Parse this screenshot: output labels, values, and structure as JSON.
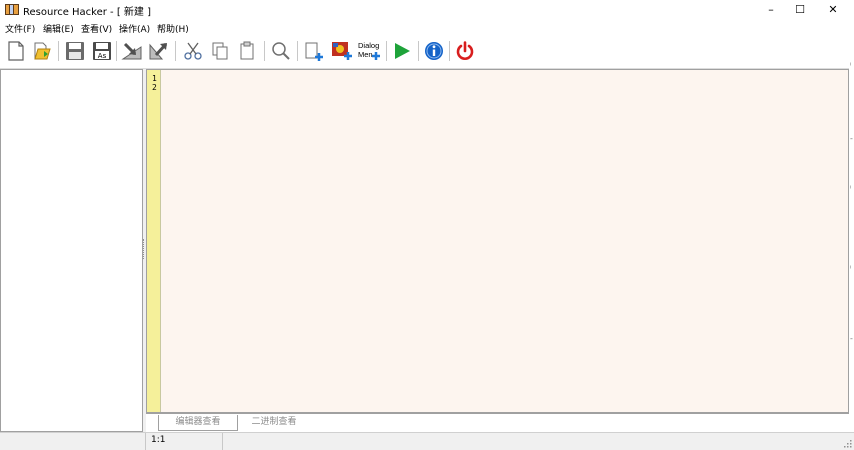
{
  "window": {
    "title": "Resource Hacker - [ 新建 ]",
    "app_icon": "resource-hacker-app-icon",
    "controls": {
      "minimize": "–",
      "maximize": "☐",
      "close": "✕"
    }
  },
  "menubar": {
    "items": [
      {
        "label": "文件(F)"
      },
      {
        "label": "编辑(E)"
      },
      {
        "label": "查看(V)"
      },
      {
        "label": "操作(A)"
      },
      {
        "label": "帮助(H)"
      }
    ]
  },
  "toolbar": {
    "buttons": [
      {
        "name": "new-file-icon"
      },
      {
        "name": "open-folder-icon"
      },
      {
        "name": "save-icon"
      },
      {
        "name": "save-as-icon",
        "label": "As"
      },
      {
        "name": "import-resource-icon"
      },
      {
        "name": "export-resource-icon"
      },
      {
        "name": "cut-icon"
      },
      {
        "name": "copy-icon"
      },
      {
        "name": "paste-icon"
      },
      {
        "name": "search-icon"
      },
      {
        "name": "add-blank-resource-icon"
      },
      {
        "name": "add-image-resource-icon"
      },
      {
        "name": "dialog-menu-icon",
        "label_line1": "Dialog",
        "label_line2": "Men"
      },
      {
        "name": "compile-run-icon"
      },
      {
        "name": "info-icon"
      },
      {
        "name": "exit-power-icon"
      }
    ]
  },
  "editor": {
    "line_numbers": [
      "1",
      "2"
    ],
    "content": ""
  },
  "bottom_tabs": [
    {
      "label": "编辑器查看",
      "active": true
    },
    {
      "label": "二进制查看",
      "active": false
    }
  ],
  "statusbar": {
    "cursor_position": "1:1"
  },
  "colors": {
    "editor_bg": "#fdf5ef",
    "gutter_bg": "#f5f09a",
    "run_green": "#1ea33a",
    "info_blue": "#1463c8",
    "power_red": "#d81e1e"
  }
}
